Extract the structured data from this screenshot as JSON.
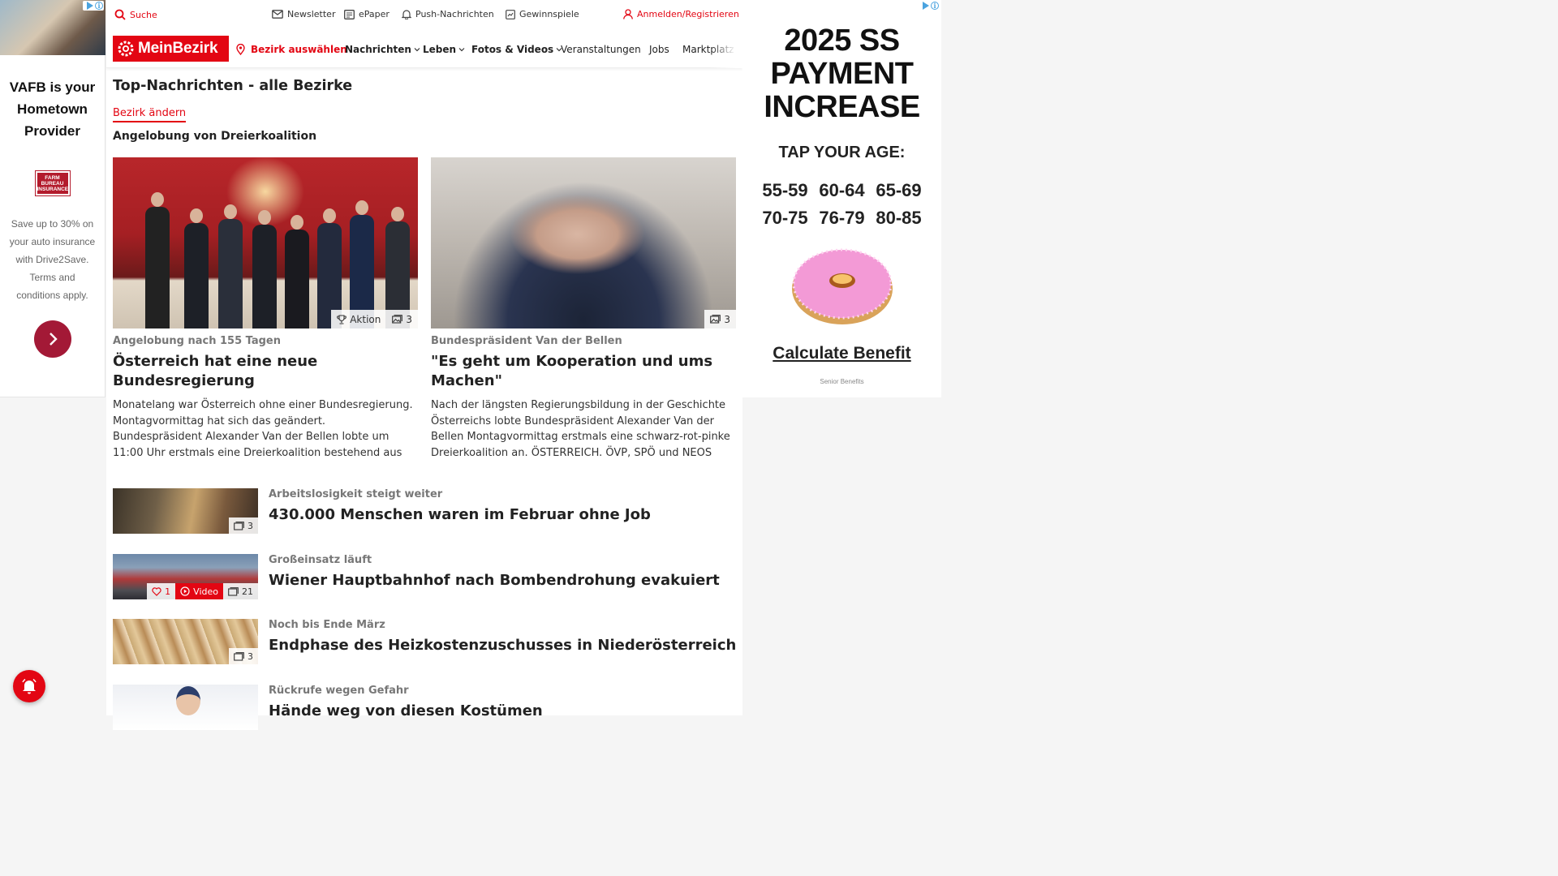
{
  "left_ad": {
    "headline": "VAFB is your Hometown Provider",
    "logo_text": "FARM BUREAU INSURANCE",
    "copy": "Save up to 30% on your auto insurance with Drive2Save. Terms and conditions apply."
  },
  "utility": {
    "search": "Suche",
    "newsletter": "Newsletter",
    "epaper": "ePaper",
    "push": "Push-Nachrichten",
    "gewinnspiele": "Gewinnspiele",
    "login": "Anmelden/Registrieren"
  },
  "brand": {
    "name": "MeinBezirk",
    "color": "#e30613"
  },
  "nav": {
    "bezirk": "Bezirk auswählen",
    "items": [
      "Nachrichten",
      "Leben",
      "Fotos & Videos",
      "Veranstaltungen",
      "Jobs",
      "Marktplatz"
    ]
  },
  "page": {
    "title": "Top-Nachrichten - alle Bezirke",
    "change_district": "Bezirk ändern",
    "topic": "Angelobung von Dreierkoalition"
  },
  "featured": [
    {
      "kicker": "Angelobung nach 155 Tagen",
      "title": "Österreich hat eine neue Bundesregierung",
      "teaser": "Monatelang war Österreich ohne einer Bundesregierung. Montagvormittag hat sich das geändert. Bundespräsident Alexander Van der Bellen lobte um 11:00 Uhr erstmals eine Dreierkoalition bestehend aus ÖVP, SP...",
      "badge_aktion": "Aktion",
      "photo_count": "3"
    },
    {
      "kicker": "Bundespräsident Van der Bellen",
      "title": "\"Es geht um Kooperation und ums Machen\"",
      "teaser": "Nach der längsten Regierungsbildung in der Geschichte Österreichs lobte Bundespräsident Alexander Van der Bellen Montagvormittag erstmals eine schwarz-rot-pinke Dreierkoalition an. ÖSTERREICH. ÖVP, SPÖ und NEOS bilde...",
      "photo_count": "3"
    }
  ],
  "list": [
    {
      "kicker": "Arbeitslosigkeit steigt weiter",
      "title": "430.000 Menschen waren im Februar ohne Job",
      "photo_count": "3"
    },
    {
      "kicker": "Großeinsatz läuft",
      "title": "Wiener Hauptbahnhof nach Bombendrohung evakuiert",
      "likes": "1",
      "video_label": "Video",
      "photo_count": "21"
    },
    {
      "kicker": "Noch bis Ende März",
      "title": "Endphase des Heizkostenzuschusses in Niederösterreich",
      "photo_count": "3"
    },
    {
      "kicker": "Rückrufe wegen Gefahr",
      "title": "Hände weg von diesen Kostümen"
    }
  ],
  "right_ad": {
    "headline": "2025 SS PAYMENT INCREASE",
    "tap": "TAP YOUR AGE:",
    "ages": [
      "55-59",
      "60-64",
      "65-69",
      "70-75",
      "76-79",
      "80-85"
    ],
    "cta": "Calculate Benefit",
    "sponsor": "Senior Benefits"
  },
  "icons": [
    "search-icon",
    "mail-icon",
    "newspaper-icon",
    "bell-icon",
    "gift-icon",
    "user-icon",
    "location-pin-icon",
    "chevron-down-icon",
    "trophy-icon",
    "image-icon",
    "heart-icon",
    "play-icon",
    "chevron-right-icon"
  ]
}
